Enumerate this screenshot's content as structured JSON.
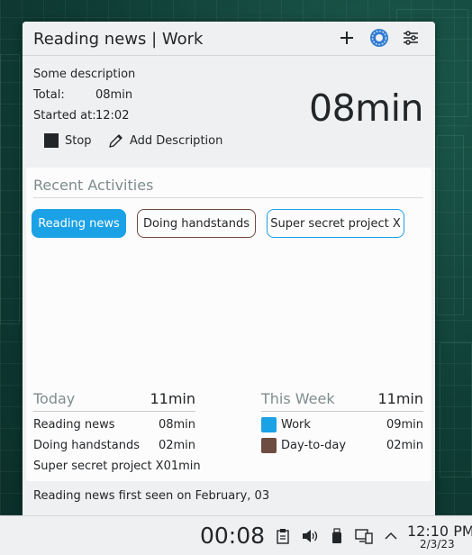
{
  "header": {
    "title": "Reading news | Work"
  },
  "info": {
    "description": "Some description",
    "total_label": "Total:",
    "total_value": "08min",
    "started_label": "Started at:",
    "started_value": "12:02",
    "big_time": "08min"
  },
  "actions": {
    "stop_label": "Stop",
    "add_description_label": "Add Description"
  },
  "recent": {
    "title": "Recent Activities",
    "chips": [
      {
        "label": "Reading news",
        "color": "#1ba1e6",
        "selected": true
      },
      {
        "label": "Doing handstands",
        "color": "#6d4c41",
        "selected": false
      },
      {
        "label": "Super secret project X",
        "color": "#1ba1e6",
        "selected": false
      }
    ]
  },
  "today": {
    "label": "Today",
    "total": "11min",
    "rows": [
      {
        "name": "Reading news",
        "value": "08min"
      },
      {
        "name": "Doing handstands",
        "value": "02min"
      },
      {
        "name": "Super secret project X",
        "value": "01min"
      }
    ]
  },
  "week": {
    "label": "This Week",
    "total": "11min",
    "rows": [
      {
        "name": "Work",
        "value": "09min",
        "color": "#1ba1e6"
      },
      {
        "name": "Day-to-day",
        "value": "02min",
        "color": "#6d4c41"
      }
    ]
  },
  "footer": {
    "note": "Reading news first seen on February, 03"
  },
  "taskbar": {
    "timer": "00:08",
    "clock_time": "12:10 PM",
    "clock_date": "2/3/23"
  },
  "icons": {
    "add": "plus-icon",
    "record": "record-icon",
    "settings": "sliders-icon",
    "stop": "stop-icon",
    "edit": "pencil-icon"
  }
}
